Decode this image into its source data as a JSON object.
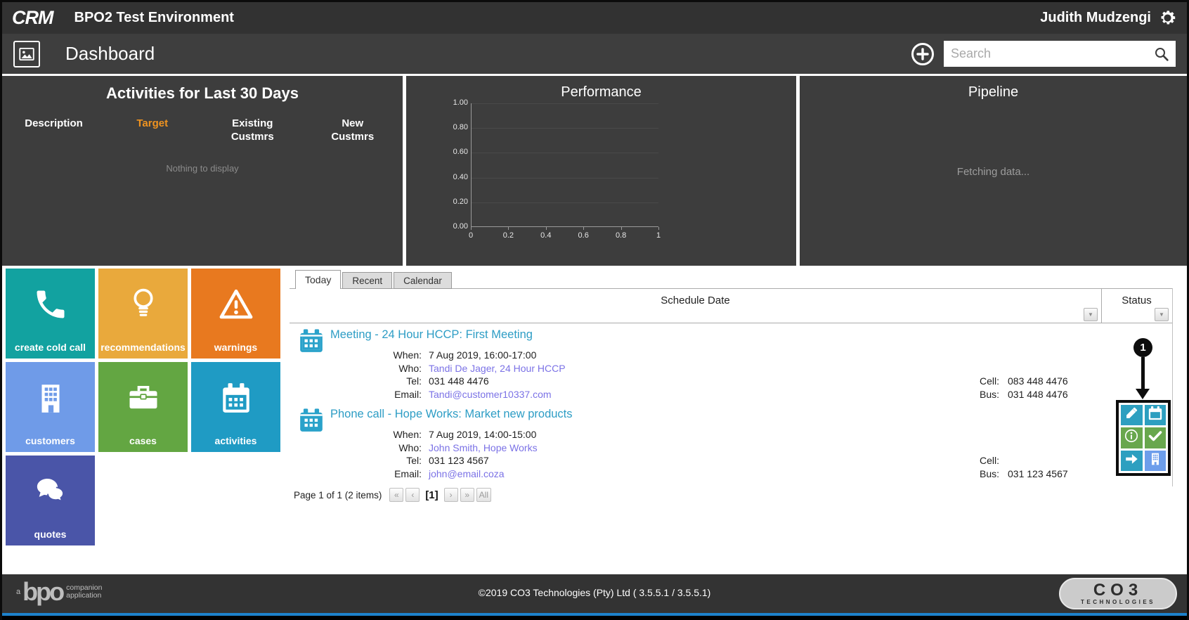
{
  "title_bar": {
    "logo_text": "CRM",
    "environment": "BPO2 Test Environment",
    "user": "Judith Mudzengi"
  },
  "header": {
    "page_title": "Dashboard",
    "search_placeholder": "Search"
  },
  "panels": {
    "activities30": {
      "title": "Activities for Last 30 Days",
      "columns": [
        "Description",
        "Target",
        "Existing Custmrs",
        "New Custmrs"
      ],
      "target_color": "#ef9320",
      "empty_text": "Nothing to display"
    },
    "performance": {
      "chart_data": {
        "type": "line",
        "title": "Performance",
        "series": [],
        "x_ticks": [
          "0",
          "0.2",
          "0.4",
          "0.6",
          "0.8",
          "1"
        ],
        "y_ticks": [
          "1.00",
          "0.80",
          "0.60",
          "0.40",
          "0.20",
          "0.00"
        ],
        "xlim": [
          0,
          1
        ],
        "ylim": [
          0,
          1
        ],
        "grid": true,
        "legend": false
      }
    },
    "pipeline": {
      "title": "Pipeline",
      "status_text": "Fetching data..."
    }
  },
  "tiles": [
    {
      "label": "create cold call",
      "color": "#12a2a0",
      "icon": "phone-icon"
    },
    {
      "label": "recommendations",
      "color": "#e9a93c",
      "icon": "lightbulb-icon"
    },
    {
      "label": "warnings",
      "color": "#e8791f",
      "icon": "warning-icon"
    },
    {
      "label": "customers",
      "color": "#6f9be8",
      "icon": "building-icon"
    },
    {
      "label": "cases",
      "color": "#63a642",
      "icon": "briefcase-icon"
    },
    {
      "label": "activities",
      "color": "#1f9bc4",
      "icon": "calendar-icon"
    },
    {
      "label": "quotes",
      "color": "#4a55a8",
      "icon": "chat-bubbles-icon"
    }
  ],
  "schedule": {
    "tabs": [
      {
        "label": "Today",
        "active": true
      },
      {
        "label": "Recent",
        "active": false
      },
      {
        "label": "Calendar",
        "active": false
      }
    ],
    "columns": {
      "schedule_date": "Schedule Date",
      "status": "Status"
    },
    "items": [
      {
        "title": "Meeting - 24 Hour HCCP: First Meeting",
        "when_label": "When:",
        "when": "7 Aug 2019, 16:00-17:00",
        "who_label": "Who:",
        "who": "Tandi De Jager, 24 Hour HCCP",
        "tel_label": "Tel:",
        "tel": "031 448 4476",
        "email_label": "Email:",
        "email": "Tandi@customer10337.com",
        "cell_label": "Cell:",
        "cell": "083 448 4476",
        "bus_label": "Bus:",
        "bus": "031 448 4476"
      },
      {
        "title": "Phone call - Hope Works: Market new products",
        "when_label": "When:",
        "when": "7 Aug 2019, 14:00-15:00",
        "who_label": "Who:",
        "who": "John Smith, Hope Works",
        "tel_label": "Tel:",
        "tel": "031 123 4567",
        "email_label": "Email:",
        "email": "john@email.coza",
        "cell_label": "Cell:",
        "cell": "",
        "bus_label": "Bus:",
        "bus": "031 123 4567"
      }
    ],
    "pager": {
      "summary": "Page 1 of 1 (2 items)",
      "first": "«",
      "prev": "‹",
      "current": "[1]",
      "next": "›",
      "last": "»",
      "all": "All"
    }
  },
  "annotation": {
    "badge_label": "1"
  },
  "status_actions": {
    "colors": {
      "blue": "#2d9fc0",
      "green": "#68a74d",
      "cornflower": "#6d9eeb"
    },
    "icons": [
      "pencil-icon",
      "calendar-icon",
      "info-icon",
      "check-icon",
      "arrow-right-icon",
      "building-icon"
    ]
  },
  "footer": {
    "copyright": "©2019 CO3 Technologies (Pty) Ltd ( 3.5.5.1 / 3.5.5.1)",
    "bpo_prefix": "a",
    "bpo_word": "bpo",
    "bpo_line1": "companion",
    "bpo_line2": "application",
    "co3_line1": "CO3",
    "co3_line2": "TECHNOLOGIES"
  }
}
